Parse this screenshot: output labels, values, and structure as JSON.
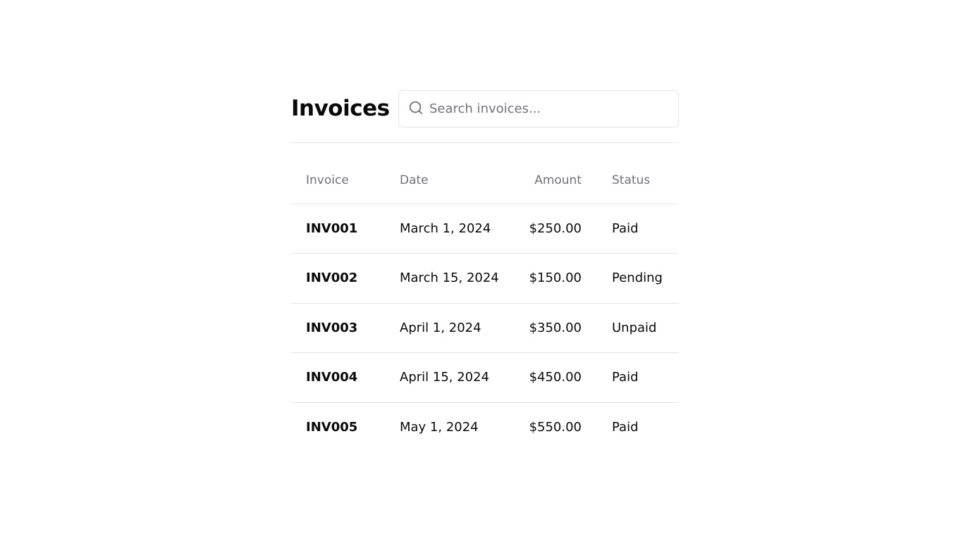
{
  "page": {
    "title": "Invoices"
  },
  "search": {
    "placeholder": "Search invoices...",
    "icon": "search-icon"
  },
  "table": {
    "columns": {
      "invoice": "Invoice",
      "date": "Date",
      "amount": "Amount",
      "status": "Status"
    },
    "rows": [
      {
        "invoice": "INV001",
        "date": "March 1, 2024",
        "amount": "$250.00",
        "status": "Paid"
      },
      {
        "invoice": "INV002",
        "date": "March 15, 2024",
        "amount": "$150.00",
        "status": "Pending"
      },
      {
        "invoice": "INV003",
        "date": "April 1, 2024",
        "amount": "$350.00",
        "status": "Unpaid"
      },
      {
        "invoice": "INV004",
        "date": "April 15, 2024",
        "amount": "$450.00",
        "status": "Paid"
      },
      {
        "invoice": "INV005",
        "date": "May 1, 2024",
        "amount": "$550.00",
        "status": "Paid"
      }
    ]
  },
  "colors": {
    "text": "#0a0a0a",
    "muted": "#71717a",
    "border": "#e4e4e7",
    "background": "#ffffff"
  }
}
